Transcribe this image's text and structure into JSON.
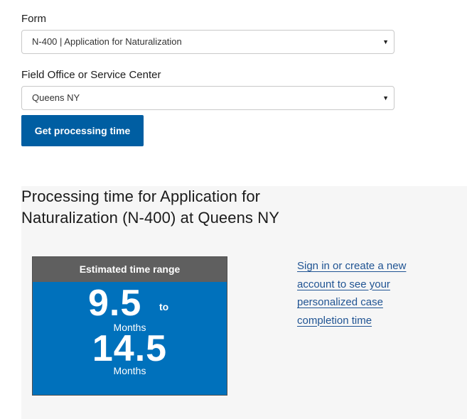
{
  "form": {
    "form_label": "Form",
    "form_value": "N-400 | Application for Naturalization",
    "office_label": "Field Office or Service Center",
    "office_value": "Queens NY",
    "submit_label": "Get processing time"
  },
  "results": {
    "heading": "Processing time for Application for Naturalization (N-400) at Queens NY",
    "card_header": "Estimated time range",
    "min_value": "9.5",
    "min_unit": "Months",
    "to_word": "to",
    "max_value": "14.5",
    "max_unit": "Months",
    "signin_link": "Sign in or create a new account to see your personalized case completion time"
  },
  "icons": {
    "dropdown": "chevron-down-icon"
  },
  "colors": {
    "button": "#005ea2",
    "card_header": "#5f5f5f",
    "card_body": "#0071bc",
    "link": "#205493",
    "results_background": "#f6f6f6"
  }
}
